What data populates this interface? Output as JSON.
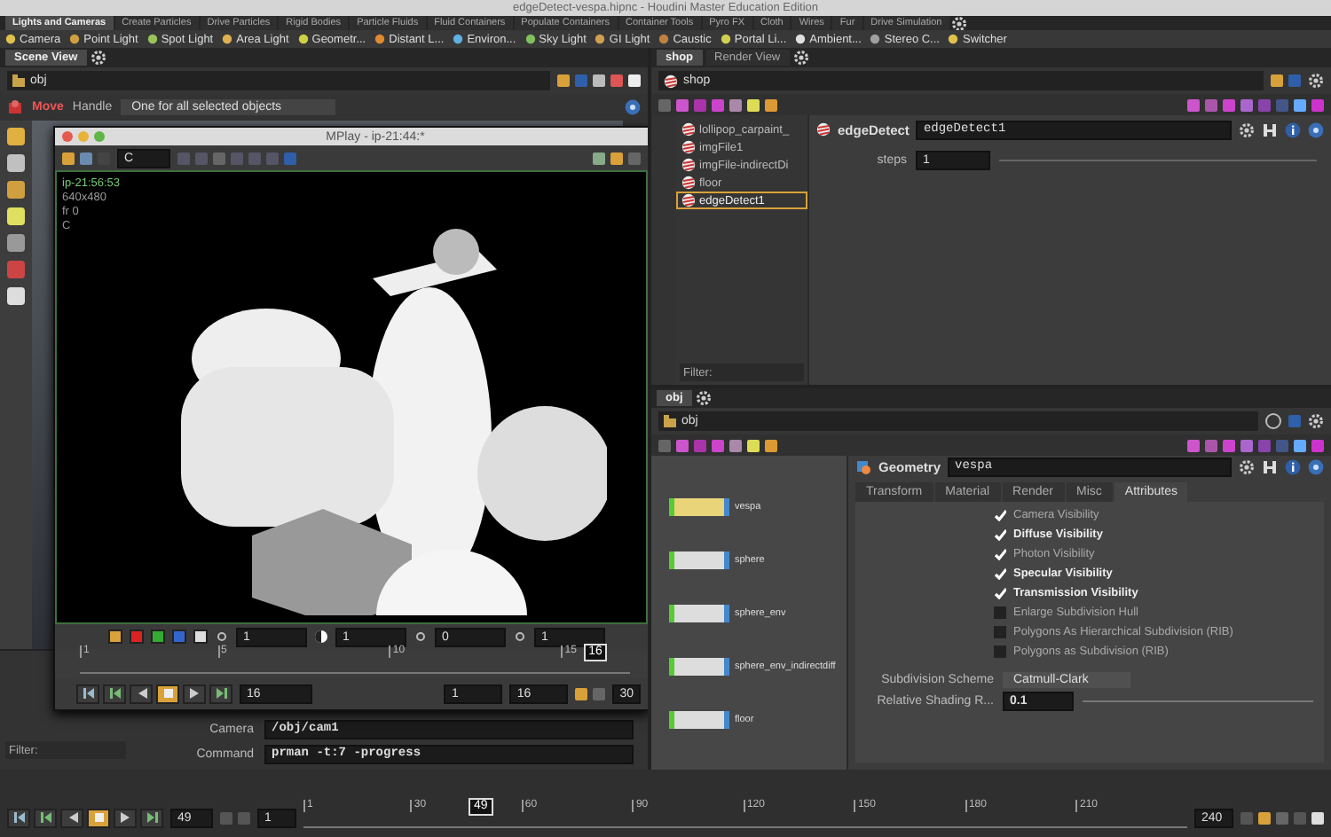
{
  "window": {
    "title": "edgeDetect-vespa.hipnc - Houdini Master Education Edition"
  },
  "shelf_tabs": [
    {
      "label": "Lights and Cameras",
      "selected": true
    },
    {
      "label": "Create Particles",
      "selected": false
    },
    {
      "label": "Drive Particles",
      "selected": false
    },
    {
      "label": "Rigid Bodies",
      "selected": false
    },
    {
      "label": "Particle Fluids",
      "selected": false
    },
    {
      "label": "Fluid Containers",
      "selected": false
    },
    {
      "label": "Populate Containers",
      "selected": false
    },
    {
      "label": "Container Tools",
      "selected": false
    },
    {
      "label": "Pyro FX",
      "selected": false
    },
    {
      "label": "Cloth",
      "selected": false
    },
    {
      "label": "Wires",
      "selected": false
    },
    {
      "label": "Fur",
      "selected": false
    },
    {
      "label": "Drive Simulation",
      "selected": false
    }
  ],
  "shelf_tools": [
    "Camera",
    "Point Light",
    "Spot Light",
    "Area Light",
    "Geometr...",
    "Distant L...",
    "Environ...",
    "Sky Light",
    "GI Light",
    "Caustic",
    "Portal Li...",
    "Ambient...",
    "Stereo C...",
    "Switcher"
  ],
  "scene_view": {
    "tab": "Scene View",
    "path": "obj",
    "tool": "Move",
    "handle_label": "Handle",
    "handle_mode": "One for all selected objects"
  },
  "mplay": {
    "title": "MPlay - ip-21:44:*",
    "channel": "C",
    "overlay": [
      "ip-21:56:53",
      "640x480",
      "fr 0",
      "C"
    ],
    "controls": [
      "1",
      "1",
      "0",
      "1"
    ],
    "ticks": [
      "1",
      "5",
      "10",
      "15"
    ],
    "current": "16",
    "frame": "16",
    "range_start": "1",
    "range_end": "16",
    "fps": "30"
  },
  "render_params": {
    "rows": [
      {
        "label": "Camera",
        "value": "/obj/cam1"
      },
      {
        "label": "Command",
        "value": "prman -t:7 -progress"
      }
    ],
    "filter": "Filter:"
  },
  "shop_pane": {
    "tabs": [
      {
        "label": "shop",
        "selected": true
      },
      {
        "label": "Render View",
        "selected": false
      }
    ],
    "path": "shop",
    "nodes": [
      {
        "name": "lollipop_carpaint_",
        "selected": false
      },
      {
        "name": "imgFile1",
        "selected": false
      },
      {
        "name": "imgFile-indirectDi",
        "selected": false
      },
      {
        "name": "floor",
        "selected": false
      },
      {
        "name": "edgeDetect1",
        "selected": true
      }
    ],
    "filter": "Filter:",
    "node_type": "edgeDetect",
    "node_name": "edgeDetect1",
    "params": [
      {
        "label": "steps",
        "value": "1"
      }
    ]
  },
  "obj_pane": {
    "tab": "obj",
    "path": "obj",
    "network": [
      {
        "name": "vespa",
        "selected": true
      },
      {
        "name": "sphere",
        "selected": false
      },
      {
        "name": "sphere_env",
        "selected": false
      },
      {
        "name": "sphere_env_indirectdiff",
        "selected": false
      },
      {
        "name": "floor",
        "selected": false
      }
    ],
    "node_type": "Geometry",
    "node_name": "vespa",
    "tabs": [
      {
        "label": "Transform",
        "selected": false
      },
      {
        "label": "Material",
        "selected": false
      },
      {
        "label": "Render",
        "selected": false
      },
      {
        "label": "Misc",
        "selected": false
      },
      {
        "label": "Attributes",
        "selected": true
      }
    ],
    "checkboxes": [
      {
        "label": "Camera Visibility",
        "checked": true,
        "modified": false
      },
      {
        "label": "Diffuse Visibility",
        "checked": true,
        "modified": true
      },
      {
        "label": "Photon Visibility",
        "checked": true,
        "modified": false
      },
      {
        "label": "Specular Visibility",
        "checked": true,
        "modified": true
      },
      {
        "label": "Transmission Visibility",
        "checked": true,
        "modified": true
      },
      {
        "label": "Enlarge Subdivision Hull",
        "checked": false,
        "modified": false
      },
      {
        "label": "Polygons As Hierarchical Subdivision (RIB)",
        "checked": false,
        "modified": false
      },
      {
        "label": "Polygons as Subdivision (RIB)",
        "checked": false,
        "modified": false
      }
    ],
    "subdivision": {
      "label": "Subdivision Scheme",
      "value": "Catmull-Clark"
    },
    "shading": {
      "label": "Relative Shading R...",
      "value": "0.1"
    }
  },
  "playbar": {
    "frame": "49",
    "step": "1",
    "ticks": [
      "1",
      "30",
      "60",
      "90",
      "120",
      "150",
      "180",
      "210"
    ],
    "current": "49",
    "end": "240"
  }
}
